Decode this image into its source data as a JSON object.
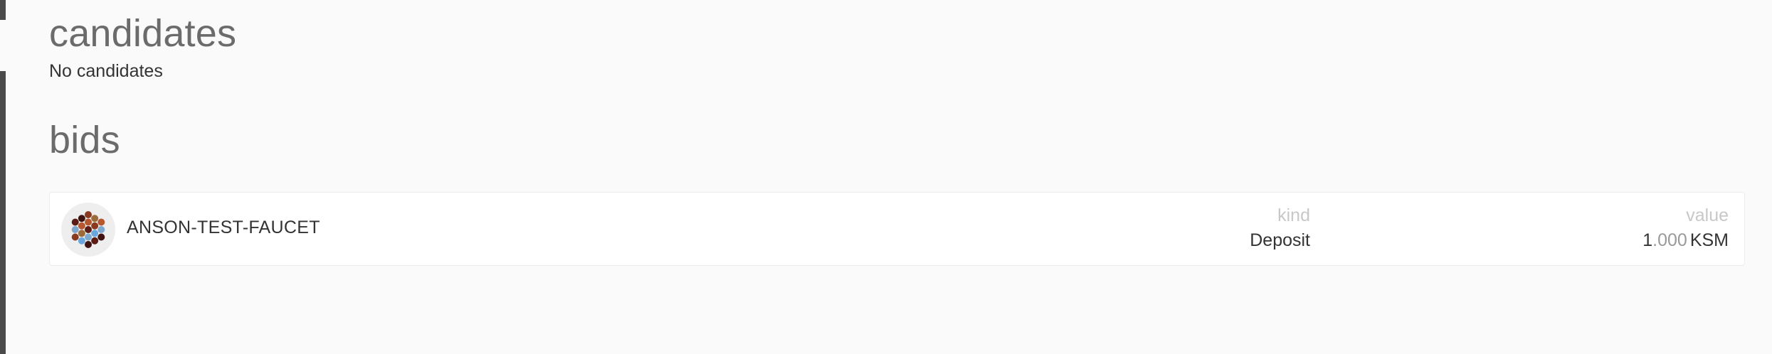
{
  "candidates": {
    "title": "candidates",
    "empty_text": "No candidates"
  },
  "bids": {
    "title": "bids",
    "items": [
      {
        "account_name": "ANSON-TEST-FAUCET",
        "kind_label": "kind",
        "kind_value": "Deposit",
        "value_label": "value",
        "value_int": "1",
        "value_dec": ".000",
        "value_unit": "KSM",
        "identicon_icon": "polkadot-identicon"
      }
    ]
  },
  "colors": {
    "background": "#fafafa",
    "card": "#ffffff",
    "title": "#6b6b6b",
    "label": "#c8c8c8",
    "text": "#333333",
    "identicon_palette": [
      "#5a1e14",
      "#8a3a1f",
      "#b5572f",
      "#7fa8cf",
      "#6aa7dd",
      "#3e1310",
      "#9c6b3a"
    ]
  }
}
